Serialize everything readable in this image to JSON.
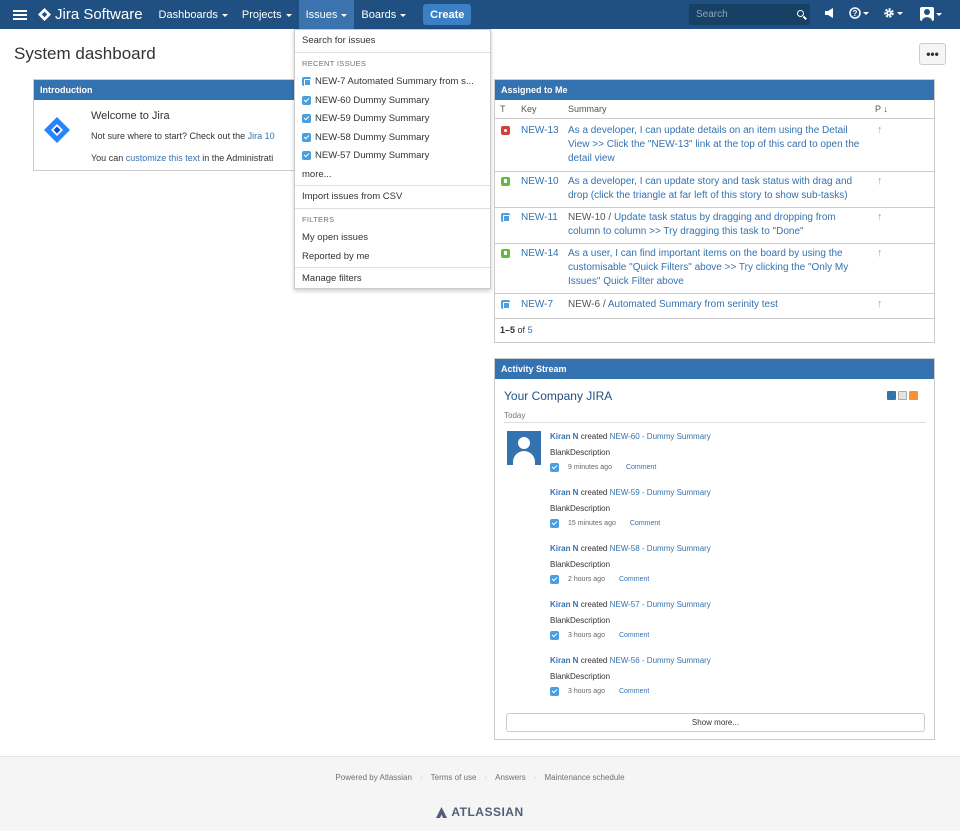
{
  "nav": {
    "logo": "Jira Software",
    "items": [
      "Dashboards",
      "Projects",
      "Issues",
      "Boards"
    ],
    "create": "Create",
    "search_placeholder": "Search"
  },
  "page": {
    "title": "System dashboard",
    "more": "•••"
  },
  "intro": {
    "header": "Introduction",
    "title": "Welcome to Jira",
    "line1_text": "Not sure where to start? Check out the ",
    "line1_link": "Jira 10",
    "line2_text": "You can ",
    "line2_link": "customize this text",
    "line2_tail": " in the Administrati"
  },
  "issues_menu": {
    "search": "Search for issues",
    "recent_heading": "RECENT ISSUES",
    "recent": [
      {
        "label": "NEW-7 Automated Summary from s...",
        "icon": "task-icon"
      },
      {
        "label": "NEW-60 Dummy Summary",
        "icon": "checkbox-icon"
      },
      {
        "label": "NEW-59 Dummy Summary",
        "icon": "checkbox-icon"
      },
      {
        "label": "NEW-58 Dummy Summary",
        "icon": "checkbox-icon"
      },
      {
        "label": "NEW-57 Dummy Summary",
        "icon": "checkbox-icon"
      }
    ],
    "more": "more...",
    "import": "Import issues from CSV",
    "filters_heading": "FILTERS",
    "filters": [
      "My open issues",
      "Reported by me"
    ],
    "manage": "Manage filters"
  },
  "assigned": {
    "header": "Assigned to Me",
    "columns": {
      "t": "T",
      "key": "Key",
      "summary": "Summary",
      "p": "P"
    },
    "rows": [
      {
        "type": "bug",
        "key": "NEW-13",
        "parent": "",
        "summary": "As a developer, I can update details on an item using the Detail View >> Click the \"NEW-13\" link at the top of this card to open the detail view",
        "priority": "↑"
      },
      {
        "type": "story",
        "key": "NEW-10",
        "parent": "",
        "summary": "As a developer, I can update story and task status with drag and drop (click the triangle at far left of this story to show sub-tasks)",
        "priority": "↑"
      },
      {
        "type": "task",
        "key": "NEW-11",
        "parent": "NEW-10",
        "summary": "Update task status by dragging and dropping from column to column >> Try dragging this task to \"Done\"",
        "priority": "↑"
      },
      {
        "type": "story",
        "key": "NEW-14",
        "parent": "",
        "summary": "As a user, I can find important items on the board by using the customisable \"Quick Filters\" above >> Try clicking the \"Only My Issues\" Quick Filter above",
        "priority": "↑"
      },
      {
        "type": "task",
        "key": "NEW-7",
        "parent": "NEW-6",
        "summary": "Automated Summary from serinity test",
        "priority": "↑"
      }
    ],
    "pager_range": "1–5",
    "pager_of": "of",
    "pager_total": "5"
  },
  "activity": {
    "header": "Activity Stream",
    "title": "Your Company JIRA",
    "today": "Today",
    "entries": [
      {
        "user": "Kiran N",
        "verb": "created",
        "issue": "NEW-60 - Dummy Summary",
        "desc": "BlankDescription",
        "time": "9 minutes ago",
        "comment": "Comment"
      },
      {
        "user": "Kiran N",
        "verb": "created",
        "issue": "NEW-59 - Dummy Summary",
        "desc": "BlankDescription",
        "time": "15 minutes ago",
        "comment": "Comment"
      },
      {
        "user": "Kiran N",
        "verb": "created",
        "issue": "NEW-58 - Dummy Summary",
        "desc": "BlankDescription",
        "time": "2 hours ago",
        "comment": "Comment"
      },
      {
        "user": "Kiran N",
        "verb": "created",
        "issue": "NEW-57 - Dummy Summary",
        "desc": "BlankDescription",
        "time": "3 hours ago",
        "comment": "Comment"
      },
      {
        "user": "Kiran N",
        "verb": "created",
        "issue": "NEW-56 - Dummy Summary",
        "desc": "BlankDescription",
        "time": "3 hours ago",
        "comment": "Comment"
      }
    ],
    "show_more": "Show more..."
  },
  "footer": {
    "links": [
      "Powered by Atlassian",
      "Terms of use",
      "Answers",
      "Maintenance schedule"
    ],
    "separator": "·",
    "brand": "ATLASSIAN"
  },
  "colors": {
    "nav": "#205081",
    "accent": "#3572b0",
    "priority": "#f79232"
  }
}
